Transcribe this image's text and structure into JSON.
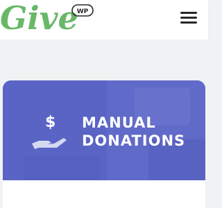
{
  "header": {
    "logo_text": "Give",
    "logo_badge": "WP",
    "menu_icon": "hamburger-menu-icon"
  },
  "banner": {
    "title_line1": "MANUAL",
    "title_line2": "DONATIONS",
    "symbol": "$",
    "icon": "hand-holding-dollar-icon"
  },
  "colors": {
    "brand_green": "#69b868",
    "banner_purple": "#5a64c5",
    "header_bg": "#ffffff",
    "page_bg": "#f1f2f4"
  }
}
